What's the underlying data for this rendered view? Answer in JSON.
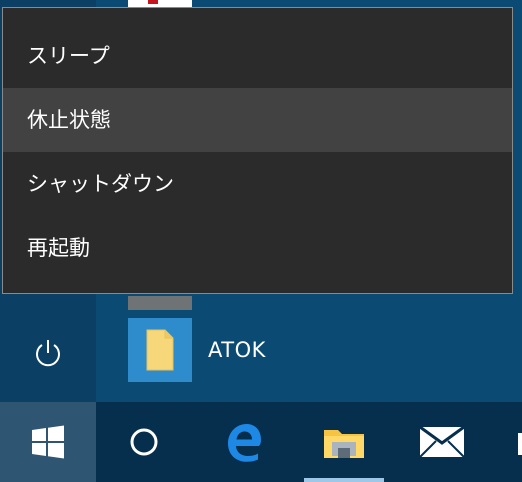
{
  "power_menu": {
    "items": [
      {
        "label": "スリープ"
      },
      {
        "label": "休止状態"
      },
      {
        "label": "シャットダウン"
      },
      {
        "label": "再起動"
      }
    ]
  },
  "start_menu": {
    "tile_label": "ATOK",
    "power_icon": "power-icon",
    "tile_icon": "document-icon"
  },
  "taskbar": {
    "icons": [
      "windows-logo-icon",
      "cortana-circle-icon",
      "edge-icon",
      "file-explorer-icon",
      "mail-icon"
    ]
  },
  "colors": {
    "menu_bg": "#2b2b2b",
    "menu_hover": "#424242",
    "taskbar_bg": "#062f4d",
    "accent": "#2f8ccc"
  }
}
